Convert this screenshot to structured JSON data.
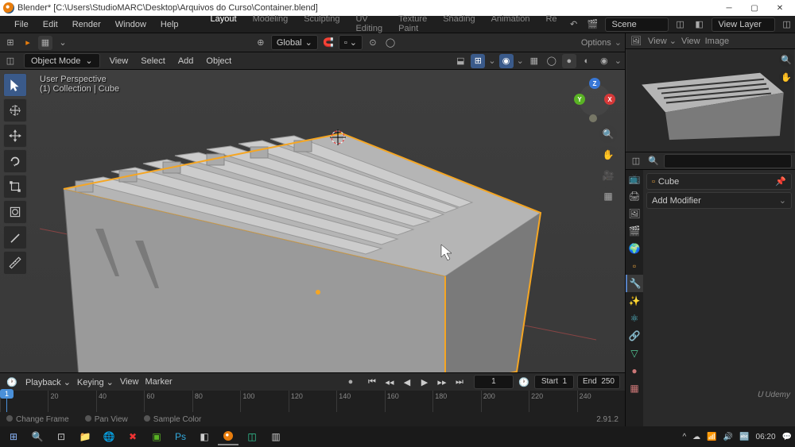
{
  "title": "Blender* [C:\\Users\\StudioMARC\\Desktop\\Arquivos do Curso\\Container.blend]",
  "menu": {
    "file": "File",
    "edit": "Edit",
    "render": "Render",
    "window": "Window",
    "help": "Help"
  },
  "workspaces": {
    "layout": "Layout",
    "modeling": "Modeling",
    "sculpting": "Sculpting",
    "uv": "UV Editing",
    "tex": "Texture Paint",
    "shading": "Shading",
    "anim": "Animation",
    "re": "Re"
  },
  "scene_bar": {
    "scene": "Scene",
    "viewlayer": "View Layer"
  },
  "view_header": {
    "orientation": "Global",
    "options": "Options",
    "mode": "Object Mode",
    "view": "View",
    "select": "Select",
    "add": "Add",
    "object": "Object",
    "persp_line1": "User Perspective",
    "persp_line2": "(1) Collection | Cube"
  },
  "right_panel": {
    "view": "View",
    "view2": "View",
    "image": "Image",
    "object_name": "Cube",
    "add_modifier": "Add Modifier"
  },
  "timeline": {
    "playback": "Playback",
    "keying": "Keying",
    "view": "View",
    "marker": "Marker",
    "frame_current": "1",
    "start_label": "Start",
    "start_value": "1",
    "end_label": "End",
    "end_value": "250",
    "ticks": [
      "1",
      "20",
      "40",
      "60",
      "80",
      "100",
      "120",
      "140",
      "160",
      "180",
      "200",
      "220",
      "240"
    ],
    "status1": "Change Frame",
    "status2": "Pan View",
    "status3": "Sample Color"
  },
  "version": "2.91.2",
  "udemy": "Udemy",
  "taskbar_time": "06:20",
  "search_placeholder": ""
}
